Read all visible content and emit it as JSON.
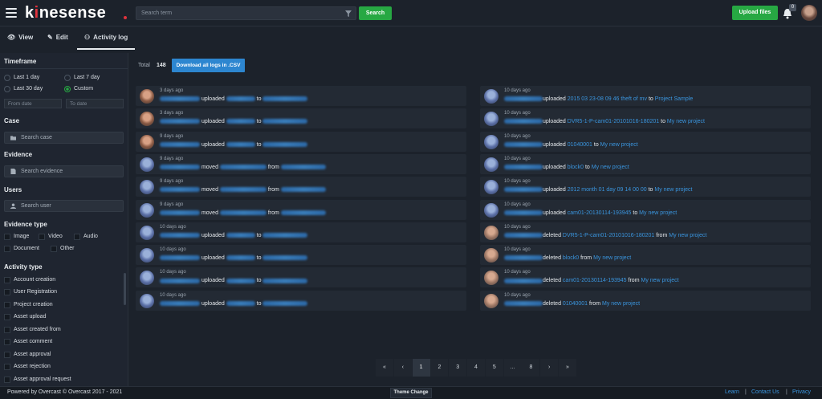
{
  "header": {
    "logo_pre": "k",
    "logo_accent": "i",
    "logo_post": "nesense",
    "search_placeholder": "Search term",
    "search_button": "Search",
    "upload_button": "Upload files",
    "notification_count": "0"
  },
  "tabs": [
    {
      "label": "View",
      "icon": "eye-icon"
    },
    {
      "label": "Edit",
      "icon": "pencil-icon"
    },
    {
      "label": "Activity log",
      "icon": "users-icon",
      "active": true
    }
  ],
  "sidebar": {
    "timeframe_title": "Timeframe",
    "timeframe_options": [
      "Last 1 day",
      "Last 7 day",
      "Last 30 day",
      "Custom"
    ],
    "timeframe_selected": "Custom",
    "from_date_placeholder": "From date",
    "to_date_placeholder": "To date",
    "case_title": "Case",
    "case_placeholder": "Search case",
    "evidence_title": "Evidence",
    "evidence_placeholder": "Search evidence",
    "users_title": "Users",
    "users_placeholder": "Search user",
    "evidence_type_title": "Evidence type",
    "evidence_types": [
      "Image",
      "Video",
      "Audio",
      "Document",
      "Other"
    ],
    "activity_type_title": "Activity type",
    "activity_types": [
      "Account creation",
      "User Registration",
      "Project creation",
      "Asset upload",
      "Asset created from",
      "Asset comment",
      "Asset approval",
      "Asset rejection",
      "Asset approval request"
    ]
  },
  "main": {
    "total_label": "Total",
    "total_value": "148",
    "download_button": "Download all logs in .CSV"
  },
  "activity_left": [
    {
      "time": "3 days ago",
      "verb": "uploaded",
      "prep": "to",
      "avatar": "a1"
    },
    {
      "time": "3 days ago",
      "verb": "uploaded",
      "prep": "to",
      "avatar": "a1"
    },
    {
      "time": "9 days ago",
      "verb": "uploaded",
      "prep": "to",
      "avatar": "a1"
    },
    {
      "time": "9 days ago",
      "verb": "moved",
      "prep": "from",
      "avatar": "a2"
    },
    {
      "time": "9 days ago",
      "verb": "moved",
      "prep": "from",
      "avatar": "a2"
    },
    {
      "time": "9 days ago",
      "verb": "moved",
      "prep": "from",
      "avatar": "a2"
    },
    {
      "time": "10 days ago",
      "verb": "uploaded",
      "prep": "to",
      "avatar": "a2"
    },
    {
      "time": "10 days ago",
      "verb": "uploaded",
      "prep": "to",
      "avatar": "a2"
    },
    {
      "time": "10 days ago",
      "verb": "uploaded",
      "prep": "to",
      "avatar": "a2"
    },
    {
      "time": "10 days ago",
      "verb": "uploaded",
      "prep": "to",
      "avatar": "a2"
    }
  ],
  "activity_right": [
    {
      "time": "10 days ago",
      "verb": "uploaded",
      "item": "2015 03 23-08 09 46 theft of mv",
      "prep": "to",
      "target": "Project Sample",
      "avatar": "a2"
    },
    {
      "time": "10 days ago",
      "verb": "uploaded",
      "item": "DVR5-1-P-cam01-20101016-180201",
      "prep": "to",
      "target": "My new project",
      "avatar": "a2"
    },
    {
      "time": "10 days ago",
      "verb": "uploaded",
      "item": "01040001",
      "prep": "to",
      "target": "My new project",
      "avatar": "a2"
    },
    {
      "time": "10 days ago",
      "verb": "uploaded",
      "item": "block0",
      "prep": "to",
      "target": "My new project",
      "avatar": "a2"
    },
    {
      "time": "10 days ago",
      "verb": "uploaded",
      "item": "2012 month 01 day 09    14 00 00",
      "prep": "to",
      "target": "My new project",
      "avatar": "a2"
    },
    {
      "time": "10 days ago",
      "verb": "uploaded",
      "item": "cam01-20130114-193945",
      "prep": "to",
      "target": "My new project",
      "avatar": "a2"
    },
    {
      "time": "10 days ago",
      "verb": "deleted",
      "item": "DVR5-1-P-cam01-20101016-180201",
      "prep": "from",
      "target": "My new project",
      "avatar": "a3"
    },
    {
      "time": "10 days ago",
      "verb": "deleted",
      "item": "block0",
      "prep": "from",
      "target": "My new project",
      "avatar": "a3"
    },
    {
      "time": "10 days ago",
      "verb": "deleted",
      "item": "cam01-20130114-193945",
      "prep": "from",
      "target": "My new project",
      "avatar": "a3"
    },
    {
      "time": "10 days ago",
      "verb": "deleted",
      "item": "01040001",
      "prep": "from",
      "target": "My new project",
      "avatar": "a3"
    }
  ],
  "pagination": [
    "«",
    "‹",
    "1",
    "2",
    "3",
    "4",
    "5",
    "...",
    "8",
    "›",
    "»"
  ],
  "pagination_active": "1",
  "footer": {
    "powered": "Powered by Overcast  ©  Overcast  2017 - 2021",
    "theme_button": "Theme Change",
    "links": [
      "Learn",
      "Contact Us",
      "Privacy"
    ]
  },
  "colors": {
    "accent_green": "#27a843",
    "link_blue": "#3a95de",
    "logo_red": "#e0333d",
    "download_blue": "#2d86d0"
  }
}
